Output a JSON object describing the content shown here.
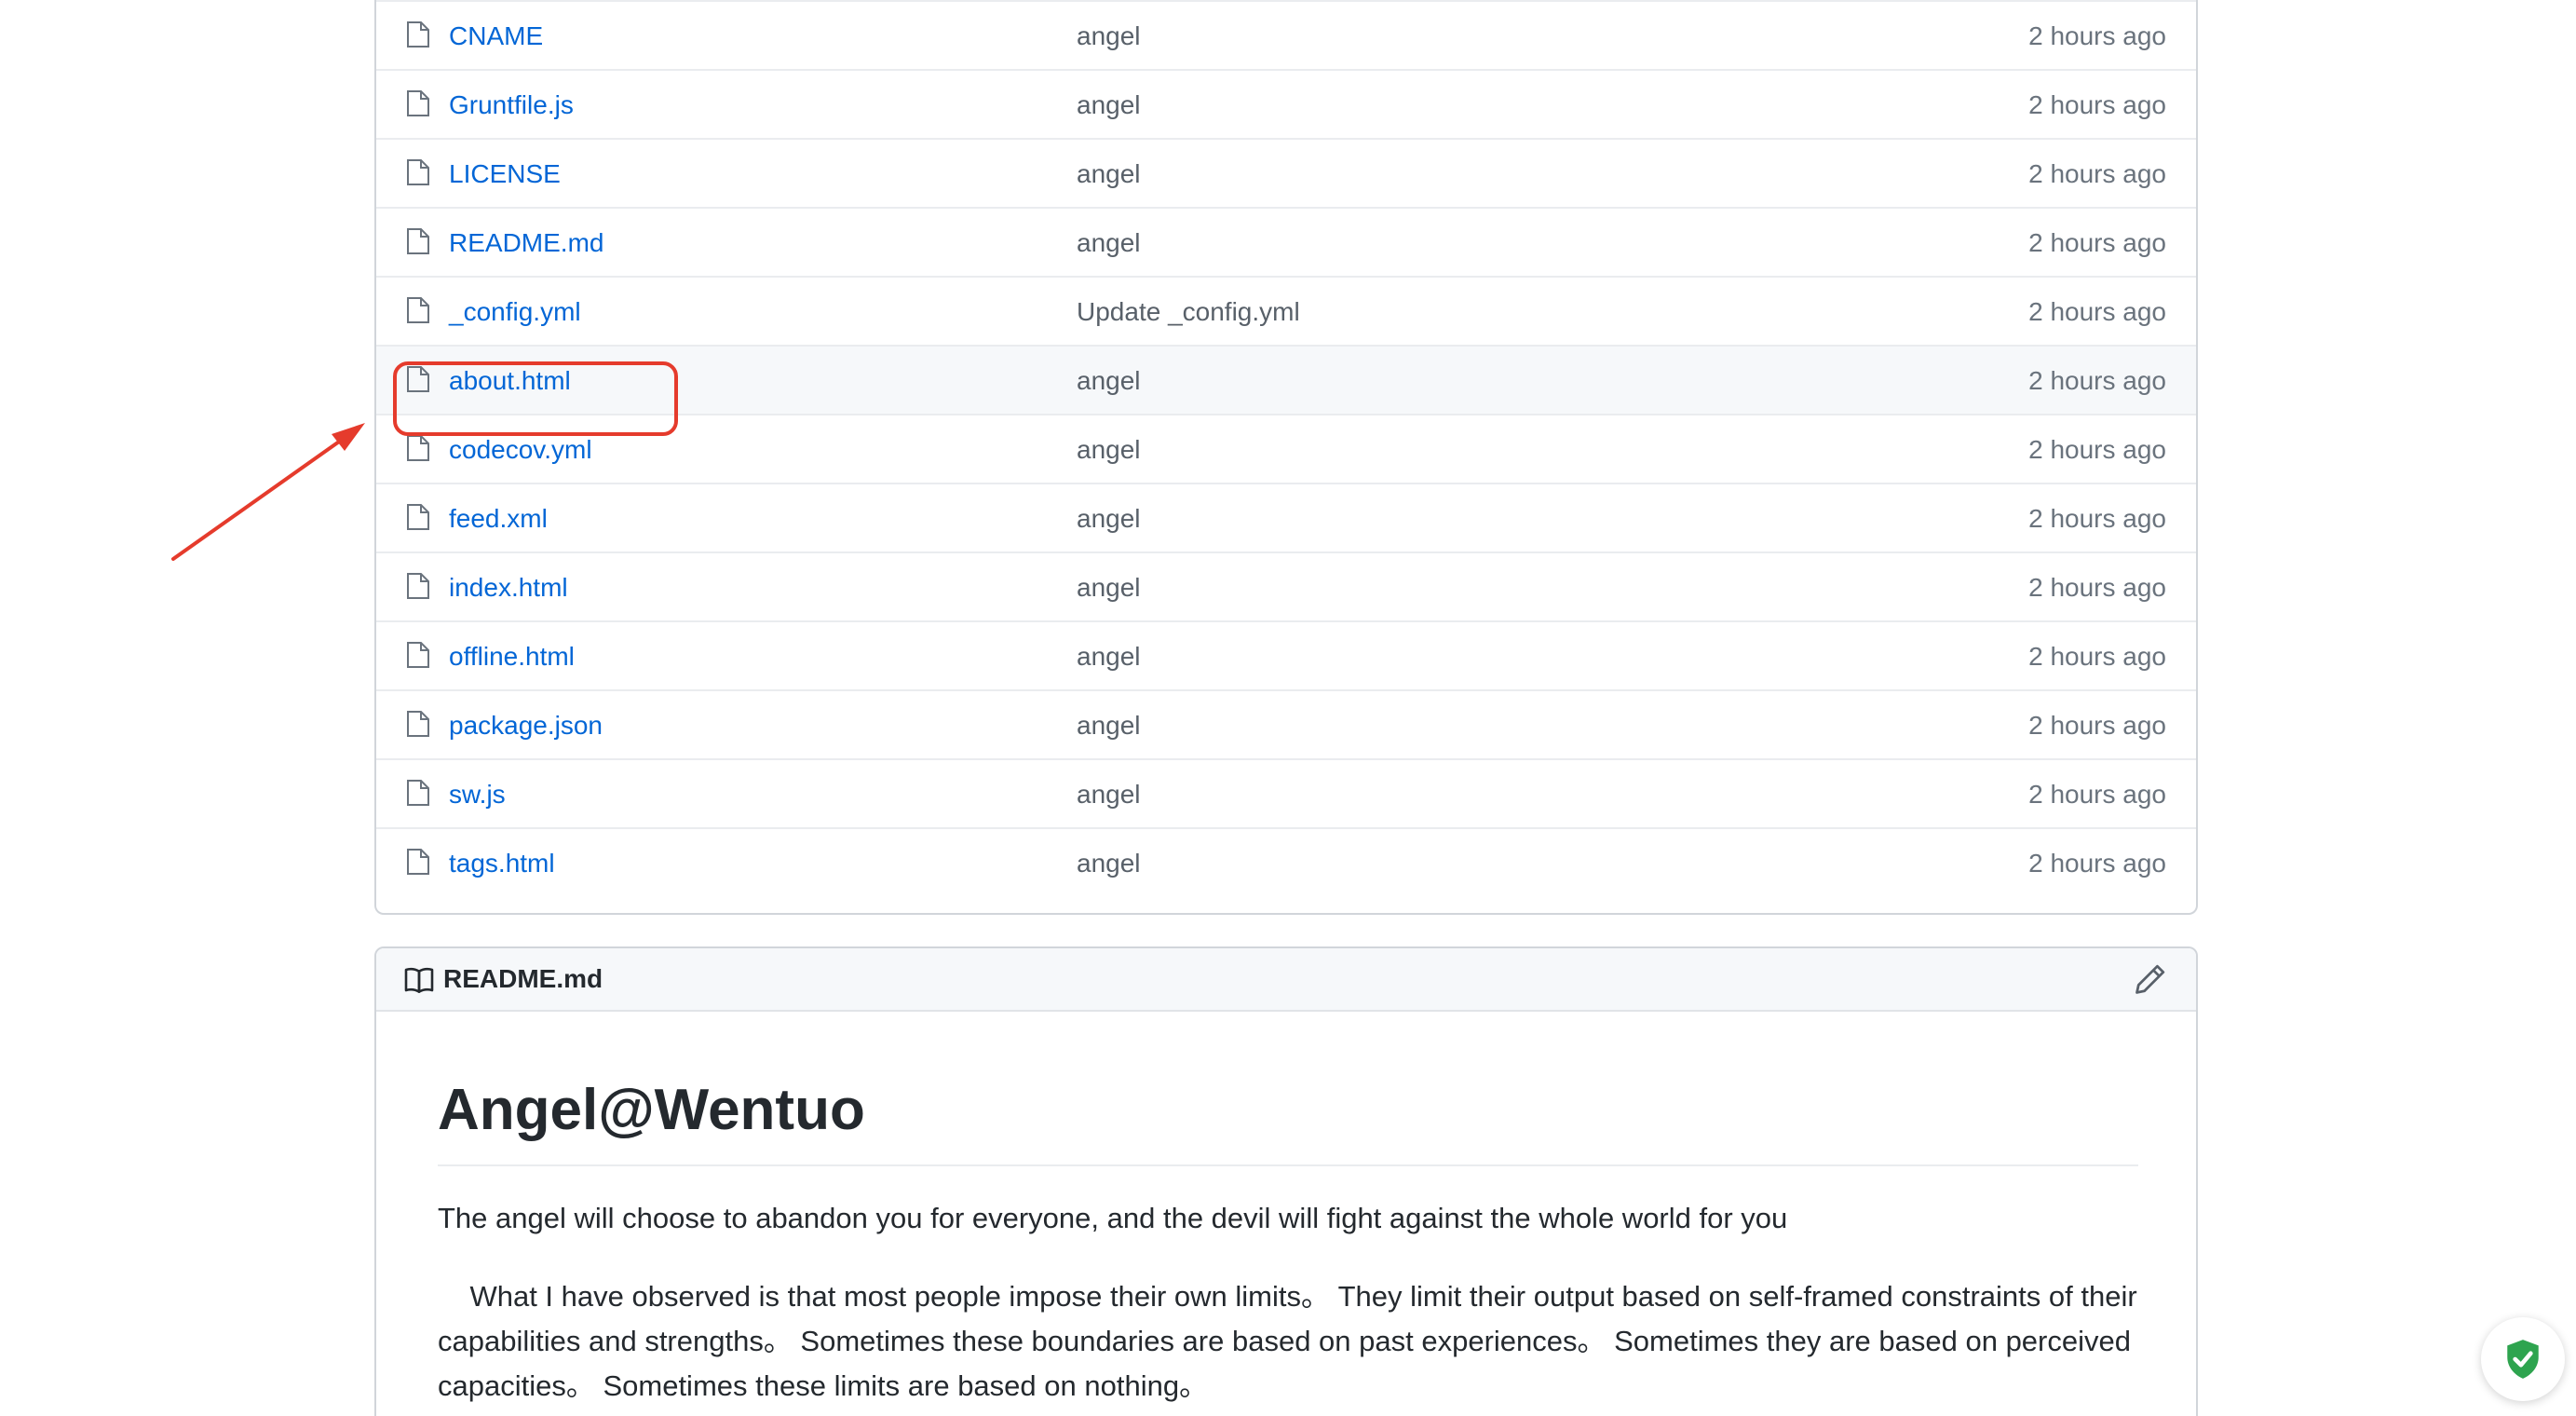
{
  "files": [
    {
      "name": "CNAME",
      "commit": "angel",
      "age": "2 hours ago"
    },
    {
      "name": "Gruntfile.js",
      "commit": "angel",
      "age": "2 hours ago"
    },
    {
      "name": "LICENSE",
      "commit": "angel",
      "age": "2 hours ago"
    },
    {
      "name": "README.md",
      "commit": "angel",
      "age": "2 hours ago"
    },
    {
      "name": "_config.yml",
      "commit": "Update _config.yml",
      "age": "2 hours ago"
    },
    {
      "name": "about.html",
      "commit": "angel",
      "age": "2 hours ago"
    },
    {
      "name": "codecov.yml",
      "commit": "angel",
      "age": "2 hours ago"
    },
    {
      "name": "feed.xml",
      "commit": "angel",
      "age": "2 hours ago"
    },
    {
      "name": "index.html",
      "commit": "angel",
      "age": "2 hours ago"
    },
    {
      "name": "offline.html",
      "commit": "angel",
      "age": "2 hours ago"
    },
    {
      "name": "package.json",
      "commit": "angel",
      "age": "2 hours ago"
    },
    {
      "name": "sw.js",
      "commit": "angel",
      "age": "2 hours ago"
    },
    {
      "name": "tags.html",
      "commit": "angel",
      "age": "2 hours ago"
    }
  ],
  "highlighted_file": "about.html",
  "readme": {
    "header_title": "README.md",
    "heading": "Angel@Wentuo",
    "paragraph1": "The angel will choose to abandon you for everyone, and the devil will fight against the whole world for you",
    "paragraph2": "    What I have observed is that most people impose their own limits。 They limit their output based on self-framed constraints of their capabilities and strengths。 Sometimes these boundaries are based on past experiences。 Sometimes they are based on perceived capacities。 Sometimes these limits are based on nothing。"
  },
  "icons": {
    "file": "file-icon",
    "readme": "book-icon",
    "edit": "pencil-icon",
    "security": "shield-check-icon"
  },
  "colors": {
    "link": "#0366d6",
    "annotation": "#e53b2c",
    "shield": "#2ea44f"
  }
}
